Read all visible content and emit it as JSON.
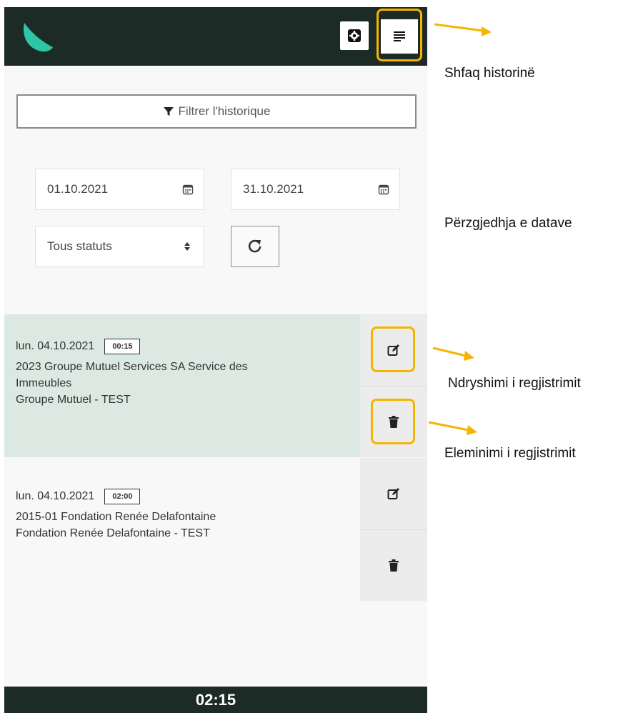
{
  "header": {
    "settings_icon": "gear-icon",
    "menu_icon": "list-icon"
  },
  "filter": {
    "label": "Filtrer l'historique",
    "icon": "funnel-icon"
  },
  "date_range": {
    "from": "01.10.2021",
    "to": "31.10.2021",
    "icon": "calendar-icon"
  },
  "status_select": {
    "value": "Tous statuts"
  },
  "entries": [
    {
      "date": "lun. 04.10.2021",
      "duration": "00:15",
      "line1": "2023 Groupe Mutuel Services SA Service des",
      "line2": "Immeubles",
      "line3": "Groupe Mutuel - TEST"
    },
    {
      "date": "lun. 04.10.2021",
      "duration": "02:00",
      "line1": "2015-01 Fondation Renée Delafontaine",
      "line2": "Fondation Renée Delafontaine - TEST"
    }
  ],
  "footer": {
    "total": "02:15"
  },
  "annotations": {
    "show_history": "Shfaq historinë",
    "date_selection": "Përzgjedhja e datave",
    "edit_entry": "Ndryshimi i regjistrimit",
    "delete_entry": "Eleminimi i regjistrimit"
  },
  "colors": {
    "header_bg": "#1d2b26",
    "accent": "#2ec4a6",
    "highlight": "#f6b400",
    "selected_row": "#dce9e3"
  }
}
